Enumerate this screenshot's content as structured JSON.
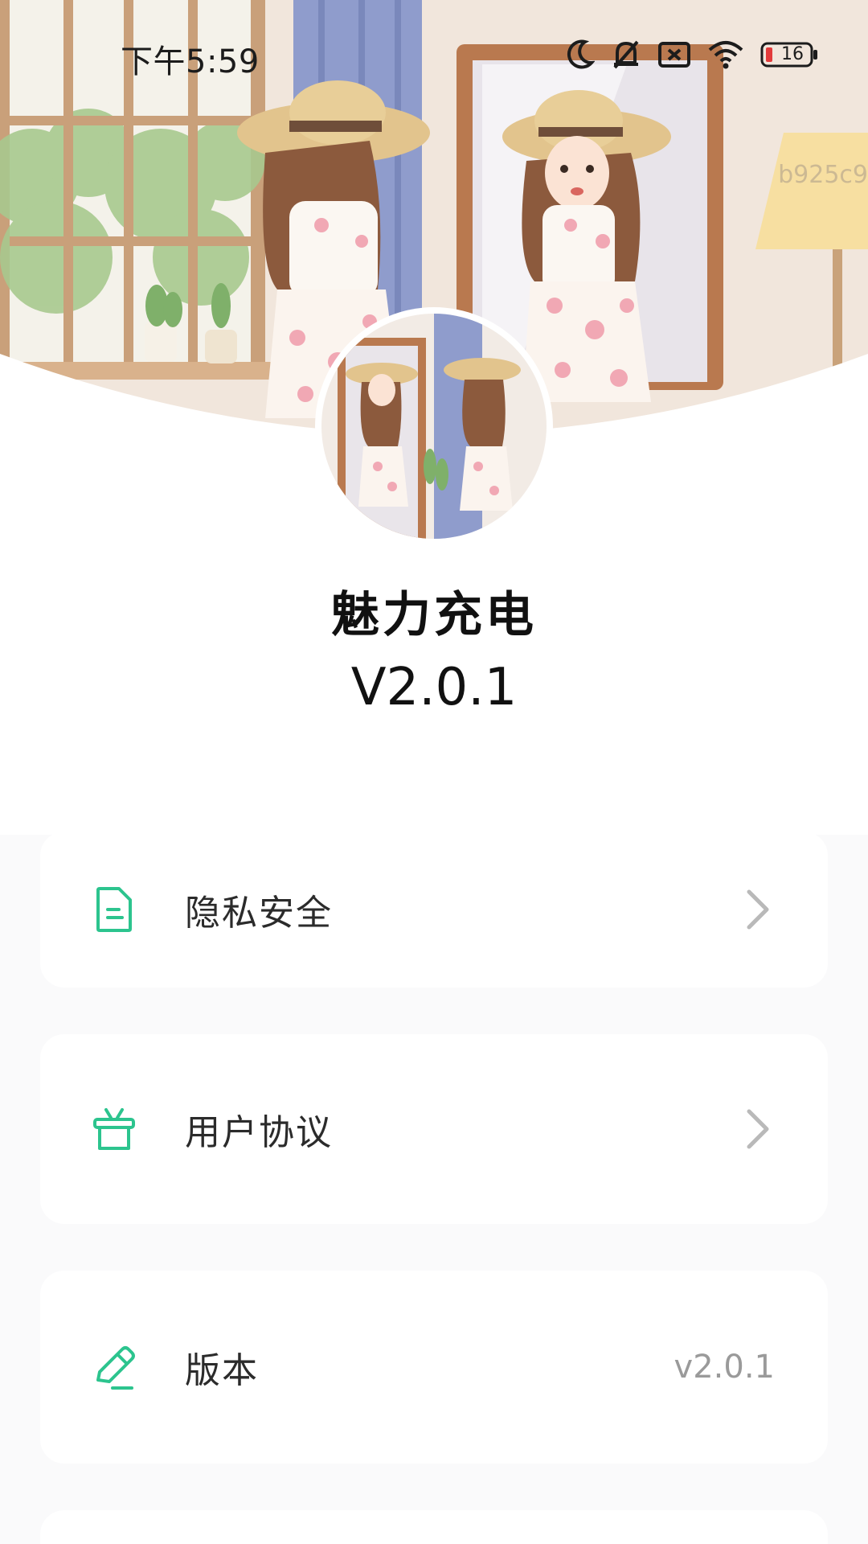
{
  "status_bar": {
    "time": "下午5:59",
    "battery_level": "16",
    "icons": [
      "moon-icon",
      "bell-muted-icon",
      "sim-error-icon",
      "wifi-icon",
      "battery-icon"
    ]
  },
  "watermark": "b925c9",
  "app": {
    "name": "魅力充电",
    "version": "V2.0.1"
  },
  "menu": {
    "items": [
      {
        "label": "隐私安全",
        "icon": "document-icon",
        "trailing": "chevron"
      },
      {
        "label": "用户协议",
        "icon": "gift-icon",
        "trailing": "chevron"
      },
      {
        "label": "版本",
        "icon": "pencil-icon",
        "trailing_value": "v2.0.1"
      }
    ]
  },
  "colors": {
    "accent": "#2cc48e",
    "text_primary": "#111111",
    "text_muted": "#9a9a9a",
    "list_background": "#fafafb"
  }
}
